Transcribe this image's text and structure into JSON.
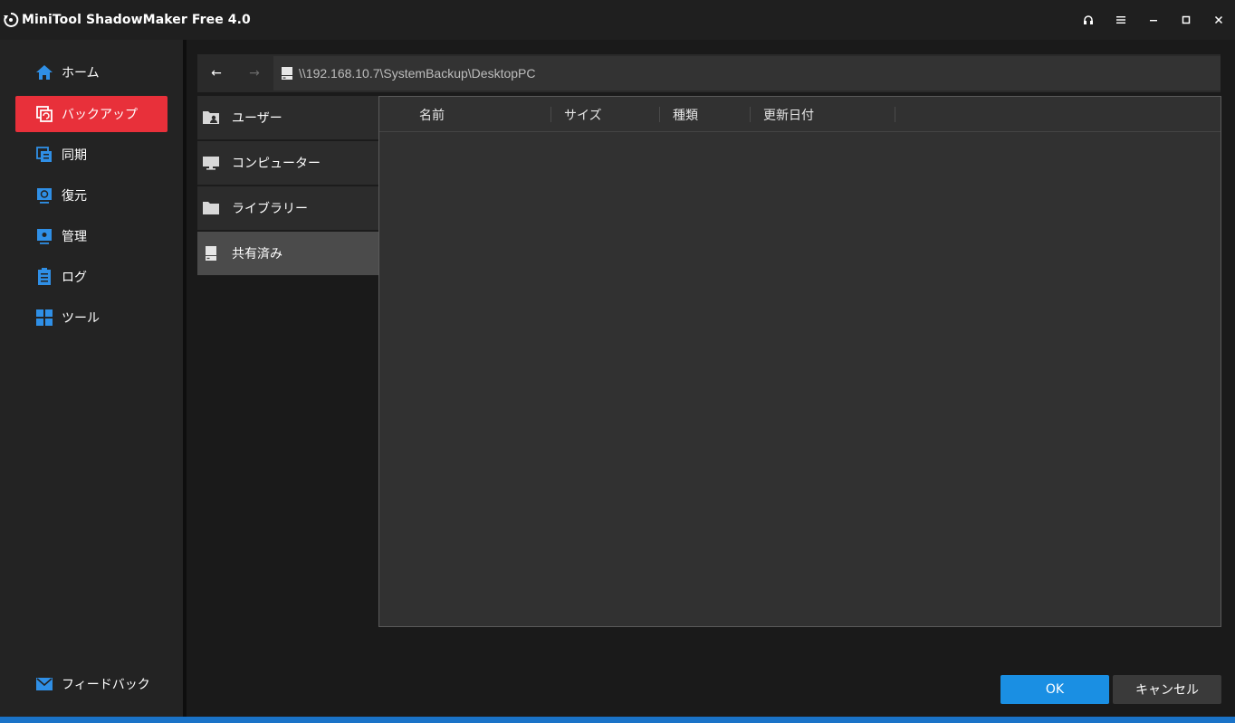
{
  "window": {
    "title": "MiniTool ShadowMaker Free 4.0",
    "controls": [
      "headset-icon",
      "menu-icon",
      "minimize-icon",
      "maximize-icon",
      "close-icon"
    ]
  },
  "sidebar": {
    "items": [
      {
        "label": "ホーム",
        "icon": "home-icon",
        "active": false
      },
      {
        "label": "バックアップ",
        "icon": "backup-icon",
        "active": true
      },
      {
        "label": "同期",
        "icon": "sync-icon",
        "active": false
      },
      {
        "label": "復元",
        "icon": "restore-icon",
        "active": false
      },
      {
        "label": "管理",
        "icon": "manage-icon",
        "active": false
      },
      {
        "label": "ログ",
        "icon": "log-icon",
        "active": false
      },
      {
        "label": "ツール",
        "icon": "tools-icon",
        "active": false
      }
    ],
    "feedback": {
      "label": "フィードバック",
      "icon": "mail-icon"
    }
  },
  "navbar": {
    "path": "\\\\192.168.10.7\\SystemBackup\\DesktopPC"
  },
  "locations": [
    {
      "label": "ユーザー",
      "icon": "user-folder-icon",
      "selected": false
    },
    {
      "label": "コンピューター",
      "icon": "monitor-icon",
      "selected": false
    },
    {
      "label": "ライブラリー",
      "icon": "folder-icon",
      "selected": false
    },
    {
      "label": "共有済み",
      "icon": "network-drive-icon",
      "selected": true
    }
  ],
  "file_list": {
    "columns": [
      "名前",
      "サイズ",
      "種類",
      "更新日付"
    ],
    "rows": []
  },
  "buttons": {
    "ok": "OK",
    "cancel": "キャンセル"
  },
  "colors": {
    "accent_red": "#e8303a",
    "accent_blue": "#1a8fe3"
  }
}
